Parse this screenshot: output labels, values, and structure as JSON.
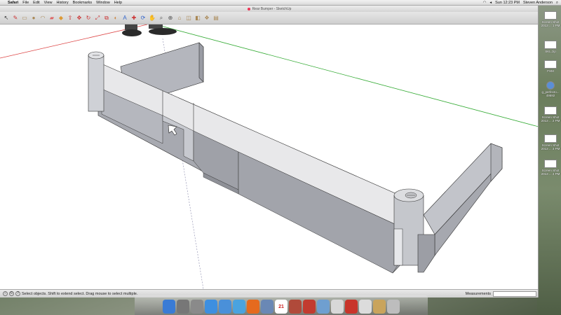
{
  "menubar": {
    "app": "Safari",
    "items": [
      "File",
      "Edit",
      "View",
      "History",
      "Bookmarks",
      "Window",
      "Help"
    ],
    "clock": "Sun 12:23 PM",
    "user": "Steven Anderson"
  },
  "window": {
    "title": "Rear Bumper - SketchUp"
  },
  "toolbar": {
    "tools": [
      "select-arrow-icon",
      "pencil-icon",
      "rectangle-icon",
      "circle-icon",
      "arc-icon",
      "eraser-icon",
      "paint-bucket-icon",
      "push-pull-icon",
      "move-icon",
      "rotate-icon",
      "scale-icon",
      "offset-icon",
      "tape-measure-icon",
      "text-icon",
      "axes-icon",
      "orbit-icon",
      "pan-icon",
      "zoom-icon",
      "zoom-extents-icon",
      "warehouse-icon",
      "component-icon",
      "share-icon",
      "extension-icon",
      "layout-icon"
    ]
  },
  "statusbar": {
    "message": "Select objects. Shift to extend select. Drag mouse to select multiple.",
    "measurements_label": "Measurements"
  },
  "desktop": {
    "items": [
      {
        "label": "Screen Shot 2013 ... 1 PM"
      },
      {
        "label": "SKL.zip"
      },
      {
        "label": "FSM"
      },
      {
        "label": "g_perfecto... 49592"
      },
      {
        "label": "Screen Shot 2013 ... 2 PM"
      },
      {
        "label": "Screen Shot 2013 ... 3 PM"
      },
      {
        "label": "Screen Shot 2013 ... 4 PM"
      }
    ]
  },
  "dock": {
    "items": [
      "finder-icon",
      "launchpad-icon",
      "system-preferences-icon",
      "app-store-icon",
      "safari-icon",
      "itunes-icon",
      "firefox-icon",
      "mail-icon",
      "calendar-icon",
      "photo-icon",
      "iphoto-icon",
      "preview-icon",
      "textedit-icon",
      "sketchup-icon",
      "document-icon",
      "folder-icon",
      "trash-icon"
    ],
    "calendar_day": "21",
    "colors": [
      "#3a7bd5",
      "#777777",
      "#8a8a8a",
      "#3d8fe0",
      "#4a90d9",
      "#4aa3df",
      "#e56a1e",
      "#6a88b5",
      "#ffffff",
      "#b04a3a",
      "#c23b2f",
      "#6f9fd0",
      "#d8d8d8",
      "#c8342a",
      "#dcdcdc",
      "#c9a45c",
      "#bdbdbd"
    ]
  }
}
